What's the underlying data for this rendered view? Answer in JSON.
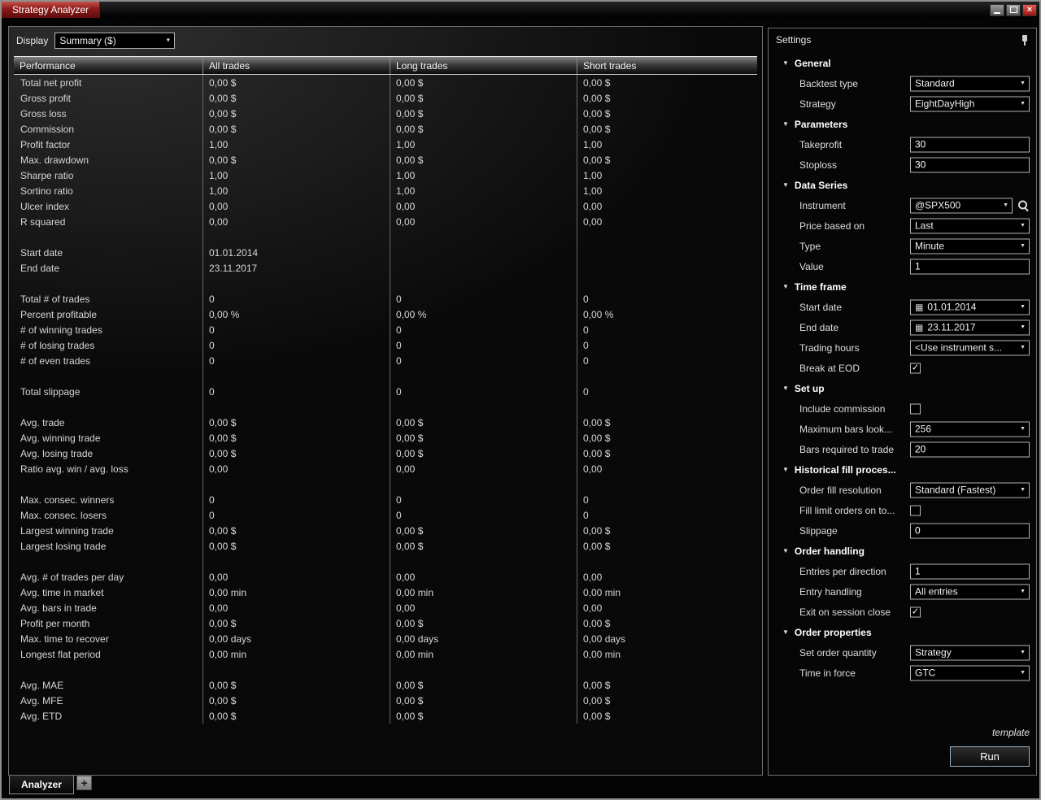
{
  "window": {
    "title": "Strategy Analyzer"
  },
  "icons": {
    "chevron_down": "▼",
    "check": "✓",
    "calendar": "▦",
    "close": "×"
  },
  "display": {
    "label": "Display",
    "value": "Summary ($)"
  },
  "table": {
    "columns": [
      "Performance",
      "All trades",
      "Long trades",
      "Short trades"
    ],
    "rows": [
      {
        "label": "Total net profit",
        "values": [
          "0,00 $",
          "0,00 $",
          "0,00 $"
        ]
      },
      {
        "label": "Gross profit",
        "values": [
          "0,00 $",
          "0,00 $",
          "0,00 $"
        ]
      },
      {
        "label": "Gross loss",
        "values": [
          "0,00 $",
          "0,00 $",
          "0,00 $"
        ]
      },
      {
        "label": "Commission",
        "values": [
          "0,00 $",
          "0,00 $",
          "0,00 $"
        ]
      },
      {
        "label": "Profit factor",
        "values": [
          "1,00",
          "1,00",
          "1,00"
        ]
      },
      {
        "label": "Max. drawdown",
        "values": [
          "0,00 $",
          "0,00 $",
          "0,00 $"
        ]
      },
      {
        "label": "Sharpe ratio",
        "values": [
          "1,00",
          "1,00",
          "1,00"
        ]
      },
      {
        "label": "Sortino ratio",
        "values": [
          "1,00",
          "1,00",
          "1,00"
        ]
      },
      {
        "label": "Ulcer index",
        "values": [
          "0,00",
          "0,00",
          "0,00"
        ]
      },
      {
        "label": "R squared",
        "values": [
          "0,00",
          "0,00",
          "0,00"
        ]
      },
      {
        "label": "",
        "values": [
          "",
          "",
          ""
        ]
      },
      {
        "label": "Start date",
        "values": [
          "01.01.2014",
          "",
          ""
        ]
      },
      {
        "label": "End date",
        "values": [
          "23.11.2017",
          "",
          ""
        ]
      },
      {
        "label": "",
        "values": [
          "",
          "",
          ""
        ]
      },
      {
        "label": "Total # of trades",
        "values": [
          "0",
          "0",
          "0"
        ]
      },
      {
        "label": "Percent profitable",
        "values": [
          "0,00 %",
          "0,00 %",
          "0,00 %"
        ]
      },
      {
        "label": "# of winning trades",
        "values": [
          "0",
          "0",
          "0"
        ]
      },
      {
        "label": "# of losing trades",
        "values": [
          "0",
          "0",
          "0"
        ]
      },
      {
        "label": "# of even trades",
        "values": [
          "0",
          "0",
          "0"
        ]
      },
      {
        "label": "",
        "values": [
          "",
          "",
          ""
        ]
      },
      {
        "label": "Total slippage",
        "values": [
          "0",
          "0",
          "0"
        ]
      },
      {
        "label": "",
        "values": [
          "",
          "",
          ""
        ]
      },
      {
        "label": "Avg. trade",
        "values": [
          "0,00 $",
          "0,00 $",
          "0,00 $"
        ]
      },
      {
        "label": "Avg. winning trade",
        "values": [
          "0,00 $",
          "0,00 $",
          "0,00 $"
        ]
      },
      {
        "label": "Avg. losing trade",
        "values": [
          "0,00 $",
          "0,00 $",
          "0,00 $"
        ]
      },
      {
        "label": "Ratio avg. win / avg. loss",
        "values": [
          "0,00",
          "0,00",
          "0,00"
        ]
      },
      {
        "label": "",
        "values": [
          "",
          "",
          ""
        ]
      },
      {
        "label": "Max. consec. winners",
        "values": [
          "0",
          "0",
          "0"
        ]
      },
      {
        "label": "Max. consec. losers",
        "values": [
          "0",
          "0",
          "0"
        ]
      },
      {
        "label": "Largest winning trade",
        "values": [
          "0,00 $",
          "0,00 $",
          "0,00 $"
        ]
      },
      {
        "label": "Largest losing trade",
        "values": [
          "0,00 $",
          "0,00 $",
          "0,00 $"
        ]
      },
      {
        "label": "",
        "values": [
          "",
          "",
          ""
        ]
      },
      {
        "label": "Avg. # of trades per day",
        "values": [
          "0,00",
          "0,00",
          "0,00"
        ]
      },
      {
        "label": "Avg. time in market",
        "values": [
          "0,00 min",
          "0,00 min",
          "0,00 min"
        ]
      },
      {
        "label": "Avg. bars in trade",
        "values": [
          "0,00",
          "0,00",
          "0,00"
        ]
      },
      {
        "label": "Profit per month",
        "values": [
          "0,00 $",
          "0,00 $",
          "0,00 $"
        ]
      },
      {
        "label": "Max. time to recover",
        "values": [
          "0,00 days",
          "0,00 days",
          "0,00 days"
        ]
      },
      {
        "label": "Longest flat period",
        "values": [
          "0,00 min",
          "0,00 min",
          "0,00 min"
        ]
      },
      {
        "label": "",
        "values": [
          "",
          "",
          ""
        ]
      },
      {
        "label": "Avg. MAE",
        "values": [
          "0,00 $",
          "0,00 $",
          "0,00 $"
        ]
      },
      {
        "label": "Avg. MFE",
        "values": [
          "0,00 $",
          "0,00 $",
          "0,00 $"
        ]
      },
      {
        "label": "Avg. ETD",
        "values": [
          "0,00 $",
          "0,00 $",
          "0,00 $"
        ]
      }
    ]
  },
  "tabs": {
    "analyzer": "Analyzer",
    "add": "+"
  },
  "settings": {
    "title": "Settings",
    "sections": [
      {
        "label": "General",
        "rows": [
          {
            "label": "Backtest type",
            "control": "select",
            "value": "Standard"
          },
          {
            "label": "Strategy",
            "control": "select",
            "value": "EightDayHigh"
          }
        ]
      },
      {
        "label": "Parameters",
        "rows": [
          {
            "label": "Takeprofit",
            "control": "text",
            "value": "30"
          },
          {
            "label": "Stoploss",
            "control": "text",
            "value": "30"
          }
        ]
      },
      {
        "label": "Data Series",
        "rows": [
          {
            "label": "Instrument",
            "control": "select-search",
            "value": "@SPX500"
          },
          {
            "label": "Price based on",
            "control": "select",
            "value": "Last"
          },
          {
            "label": "Type",
            "control": "select",
            "value": "Minute"
          },
          {
            "label": "Value",
            "control": "text",
            "value": "1"
          }
        ]
      },
      {
        "label": "Time frame",
        "rows": [
          {
            "label": "Start date",
            "control": "date",
            "value": "01.01.2014"
          },
          {
            "label": "End date",
            "control": "date",
            "value": "23.11.2017"
          },
          {
            "label": "Trading hours",
            "control": "select",
            "value": "<Use instrument s..."
          },
          {
            "label": "Break at EOD",
            "control": "checkbox",
            "checked": true
          }
        ]
      },
      {
        "label": "Set up",
        "rows": [
          {
            "label": "Include commission",
            "control": "checkbox",
            "checked": false
          },
          {
            "label": "Maximum bars look...",
            "control": "select",
            "value": "256"
          },
          {
            "label": "Bars required to trade",
            "control": "text",
            "value": "20"
          }
        ]
      },
      {
        "label": "Historical fill proces...",
        "rows": [
          {
            "label": "Order fill resolution",
            "control": "select",
            "value": "Standard (Fastest)"
          },
          {
            "label": "Fill limit orders on to...",
            "control": "checkbox",
            "checked": false
          },
          {
            "label": "Slippage",
            "control": "text",
            "value": "0"
          }
        ]
      },
      {
        "label": "Order handling",
        "rows": [
          {
            "label": "Entries per direction",
            "control": "text",
            "value": "1"
          },
          {
            "label": "Entry handling",
            "control": "select",
            "value": "All entries"
          },
          {
            "label": "Exit on session close",
            "control": "checkbox",
            "checked": true
          }
        ]
      },
      {
        "label": "Order properties",
        "rows": [
          {
            "label": "Set order quantity",
            "control": "select",
            "value": "Strategy"
          },
          {
            "label": "Time in force",
            "control": "select",
            "value": "GTC"
          }
        ]
      }
    ],
    "template_label": "template",
    "run_label": "Run"
  }
}
